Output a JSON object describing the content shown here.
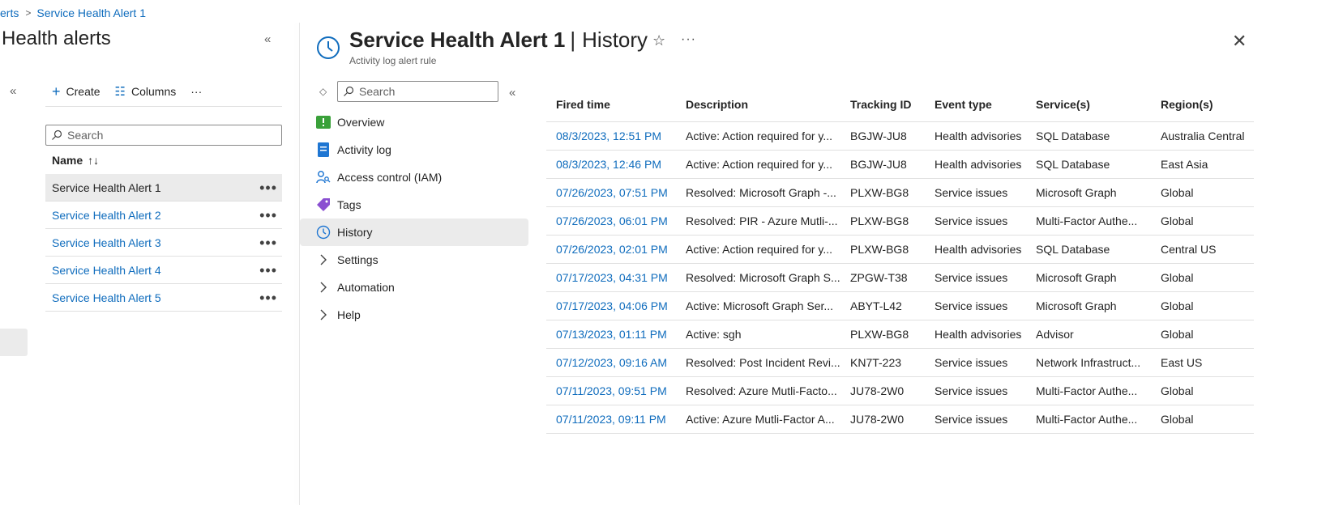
{
  "breadcrumb": {
    "parent": "erts",
    "current": "Service Health Alert 1"
  },
  "left_blade": {
    "title": "Health alerts",
    "toolbar": {
      "create": "Create",
      "columns": "Columns",
      "more": "···"
    },
    "search_placeholder": "Search",
    "column_name": "Name",
    "sort_glyph": "↑↓",
    "items": [
      {
        "label": "Service Health Alert 1",
        "selected": true
      },
      {
        "label": "Service Health Alert 2",
        "selected": false
      },
      {
        "label": "Service Health Alert 3",
        "selected": false
      },
      {
        "label": "Service Health Alert 4",
        "selected": false
      },
      {
        "label": "Service Health Alert 5",
        "selected": false
      }
    ]
  },
  "header": {
    "title": "Service Health Alert 1",
    "separator": "|",
    "section": "History",
    "subtitle": "Activity log alert rule",
    "star_glyph": "☆",
    "more_glyph": "···",
    "close_glyph": "✕"
  },
  "menu": {
    "search_placeholder": "Search",
    "items": [
      {
        "label": "Overview",
        "icon": "overview-icon"
      },
      {
        "label": "Activity log",
        "icon": "activity-log-icon"
      },
      {
        "label": "Access control (IAM)",
        "icon": "iam-icon"
      },
      {
        "label": "Tags",
        "icon": "tag-icon"
      },
      {
        "label": "History",
        "icon": "clock-icon",
        "selected": true
      },
      {
        "label": "Settings",
        "icon": "chevron-right-icon"
      },
      {
        "label": "Automation",
        "icon": "chevron-right-icon"
      },
      {
        "label": "Help",
        "icon": "chevron-right-icon"
      }
    ]
  },
  "table": {
    "columns": [
      "Fired time",
      "Description",
      "Tracking ID",
      "Event type",
      "Service(s)",
      "Region(s)"
    ],
    "rows": [
      [
        "08/3/2023, 12:51 PM",
        "Active: Action required for y...",
        "BGJW-JU8",
        "Health advisories",
        "SQL Database",
        "Australia Central"
      ],
      [
        "08/3/2023, 12:46 PM",
        "Active: Action required for y...",
        "BGJW-JU8",
        "Health advisories",
        "SQL Database",
        "East Asia"
      ],
      [
        "07/26/2023, 07:51 PM",
        "Resolved: Microsoft Graph -...",
        "PLXW-BG8",
        "Service issues",
        "Microsoft Graph",
        "Global"
      ],
      [
        "07/26/2023, 06:01 PM",
        "Resolved: PIR - Azure Mutli-...",
        "PLXW-BG8",
        "Service issues",
        "Multi-Factor Authe...",
        "Global"
      ],
      [
        "07/26/2023, 02:01 PM",
        "Active: Action required for y...",
        "PLXW-BG8",
        "Health advisories",
        "SQL Database",
        "Central US"
      ],
      [
        "07/17/2023, 04:31 PM",
        "Resolved: Microsoft Graph S...",
        "ZPGW-T38",
        "Service issues",
        "Microsoft Graph",
        "Global"
      ],
      [
        "07/17/2023, 04:06 PM",
        "Active: Microsoft Graph Ser...",
        "ABYT-L42",
        "Service issues",
        "Microsoft Graph",
        "Global"
      ],
      [
        "07/13/2023, 01:11 PM",
        "Active: sgh",
        "PLXW-BG8",
        "Health advisories",
        "Advisor",
        "Global"
      ],
      [
        "07/12/2023, 09:16 AM",
        "Resolved: Post Incident Revi...",
        "KN7T-223",
        "Service issues",
        "Network Infrastruct...",
        "East US"
      ],
      [
        "07/11/2023, 09:51 PM",
        "Resolved: Azure Mutli-Facto...",
        "JU78-2W0",
        "Service issues",
        "Multi-Factor Authe...",
        "Global"
      ],
      [
        "07/11/2023, 09:11 PM",
        "Active: Azure Mutli-Factor A...",
        "JU78-2W0",
        "Service issues",
        "Multi-Factor Authe...",
        "Global"
      ]
    ]
  },
  "colors": {
    "link": "#0f6cbd",
    "selected_bg": "#ebebeb",
    "text": "#242424"
  }
}
